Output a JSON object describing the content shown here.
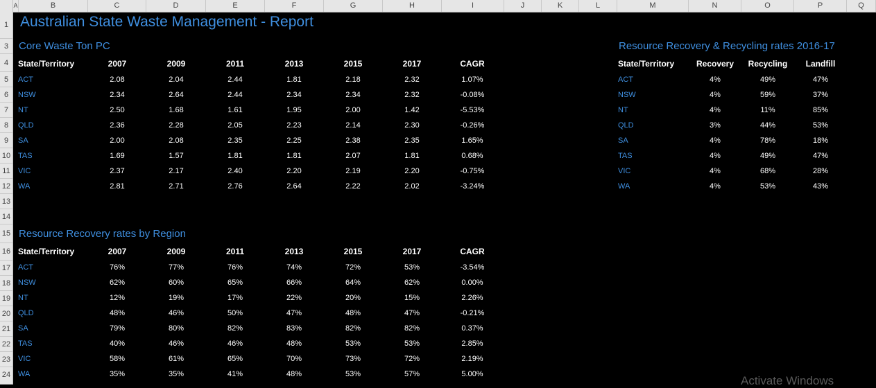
{
  "columns": [
    "A",
    "B",
    "C",
    "D",
    "E",
    "F",
    "G",
    "H",
    "I",
    "J",
    "K",
    "L",
    "M",
    "N",
    "O",
    "P",
    "Q"
  ],
  "rows": [
    "1",
    "3",
    "4",
    "5",
    "6",
    "7",
    "8",
    "9",
    "10",
    "11",
    "12",
    "13",
    "14",
    "15",
    "16",
    "17",
    "18",
    "19",
    "20",
    "21",
    "22",
    "23",
    "24"
  ],
  "title": "Australian State Waste Management - Report",
  "table1": {
    "title": "Core Waste Ton PC",
    "headers": [
      "State/Territory",
      "2007",
      "2009",
      "2011",
      "2013",
      "2015",
      "2017",
      "CAGR"
    ],
    "rows": [
      {
        "state": "ACT",
        "values": [
          "2.08",
          "2.04",
          "2.44",
          "1.81",
          "2.18",
          "2.32",
          "1.07%"
        ]
      },
      {
        "state": "NSW",
        "values": [
          "2.34",
          "2.64",
          "2.44",
          "2.34",
          "2.34",
          "2.32",
          "-0.08%"
        ]
      },
      {
        "state": "NT",
        "values": [
          "2.50",
          "1.68",
          "1.61",
          "1.95",
          "2.00",
          "1.42",
          "-5.53%"
        ]
      },
      {
        "state": "QLD",
        "values": [
          "2.36",
          "2.28",
          "2.05",
          "2.23",
          "2.14",
          "2.30",
          "-0.26%"
        ]
      },
      {
        "state": "SA",
        "values": [
          "2.00",
          "2.08",
          "2.35",
          "2.25",
          "2.38",
          "2.35",
          "1.65%"
        ]
      },
      {
        "state": "TAS",
        "values": [
          "1.69",
          "1.57",
          "1.81",
          "1.81",
          "2.07",
          "1.81",
          "0.68%"
        ]
      },
      {
        "state": "VIC",
        "values": [
          "2.37",
          "2.17",
          "2.40",
          "2.20",
          "2.19",
          "2.20",
          "-0.75%"
        ]
      },
      {
        "state": "WA",
        "values": [
          "2.81",
          "2.71",
          "2.76",
          "2.64",
          "2.22",
          "2.02",
          "-3.24%"
        ]
      }
    ]
  },
  "table2": {
    "title": "Resource Recovery rates by Region",
    "headers": [
      "State/Territory",
      "2007",
      "2009",
      "2011",
      "2013",
      "2015",
      "2017",
      "CAGR"
    ],
    "rows": [
      {
        "state": "ACT",
        "values": [
          "76%",
          "77%",
          "76%",
          "74%",
          "72%",
          "53%",
          "-3.54%"
        ]
      },
      {
        "state": "NSW",
        "values": [
          "62%",
          "60%",
          "65%",
          "66%",
          "64%",
          "62%",
          "0.00%"
        ]
      },
      {
        "state": "NT",
        "values": [
          "12%",
          "19%",
          "17%",
          "22%",
          "20%",
          "15%",
          "2.26%"
        ]
      },
      {
        "state": "QLD",
        "values": [
          "48%",
          "46%",
          "50%",
          "47%",
          "48%",
          "47%",
          "-0.21%"
        ]
      },
      {
        "state": "SA",
        "values": [
          "79%",
          "80%",
          "82%",
          "83%",
          "82%",
          "82%",
          "0.37%"
        ]
      },
      {
        "state": "TAS",
        "values": [
          "40%",
          "46%",
          "46%",
          "48%",
          "53%",
          "53%",
          "2.85%"
        ]
      },
      {
        "state": "VIC",
        "values": [
          "58%",
          "61%",
          "65%",
          "70%",
          "73%",
          "72%",
          "2.19%"
        ]
      },
      {
        "state": "WA",
        "values": [
          "35%",
          "35%",
          "41%",
          "48%",
          "53%",
          "57%",
          "5.00%"
        ]
      }
    ]
  },
  "table3": {
    "title": "Resource Recovery & Recycling rates 2016-17",
    "headers": [
      "State/Territory",
      "Recovery",
      "Recycling",
      "Landfill"
    ],
    "rows": [
      {
        "state": "ACT",
        "values": [
          "4%",
          "49%",
          "47%"
        ]
      },
      {
        "state": "NSW",
        "values": [
          "4%",
          "59%",
          "37%"
        ]
      },
      {
        "state": "NT",
        "values": [
          "4%",
          "11%",
          "85%"
        ]
      },
      {
        "state": "QLD",
        "values": [
          "3%",
          "44%",
          "53%"
        ]
      },
      {
        "state": "SA",
        "values": [
          "4%",
          "78%",
          "18%"
        ]
      },
      {
        "state": "TAS",
        "values": [
          "4%",
          "49%",
          "47%"
        ]
      },
      {
        "state": "VIC",
        "values": [
          "4%",
          "68%",
          "28%"
        ]
      },
      {
        "state": "WA",
        "values": [
          "4%",
          "53%",
          "43%"
        ]
      }
    ]
  },
  "watermark": "Activate Windows"
}
